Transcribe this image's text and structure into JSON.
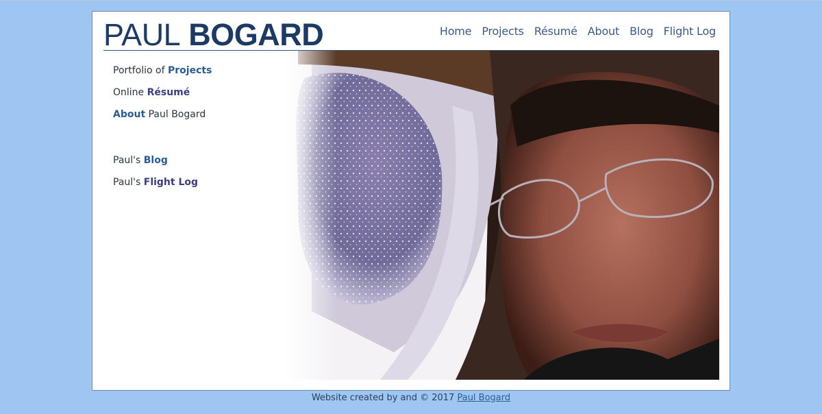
{
  "header": {
    "logo_light": "PAUL",
    "logo_bold": "BOGARD"
  },
  "nav": {
    "home": "Home",
    "projects": "Projects",
    "resume": "Résumé",
    "about": "About",
    "blog": "Blog",
    "flight_log": "Flight Log"
  },
  "sidebar": {
    "projects": {
      "prefix": "Portfolio of ",
      "link": "Projects"
    },
    "resume": {
      "prefix": "Online ",
      "link": "Résumé"
    },
    "about": {
      "link": "About",
      "suffix": " Paul Bogard"
    },
    "blog": {
      "prefix": "Paul's ",
      "link": "Blog"
    },
    "flight_log": {
      "prefix": "Paul's ",
      "link": "Flight Log"
    }
  },
  "footer": {
    "text": "Website created by and © 2017 ",
    "link": "Paul Bogard"
  },
  "colors": {
    "background": "#9fc6f2",
    "brand": "#1d3a63",
    "nav_link": "#3e5a80",
    "sidebar_link": "#2b5c8f"
  }
}
